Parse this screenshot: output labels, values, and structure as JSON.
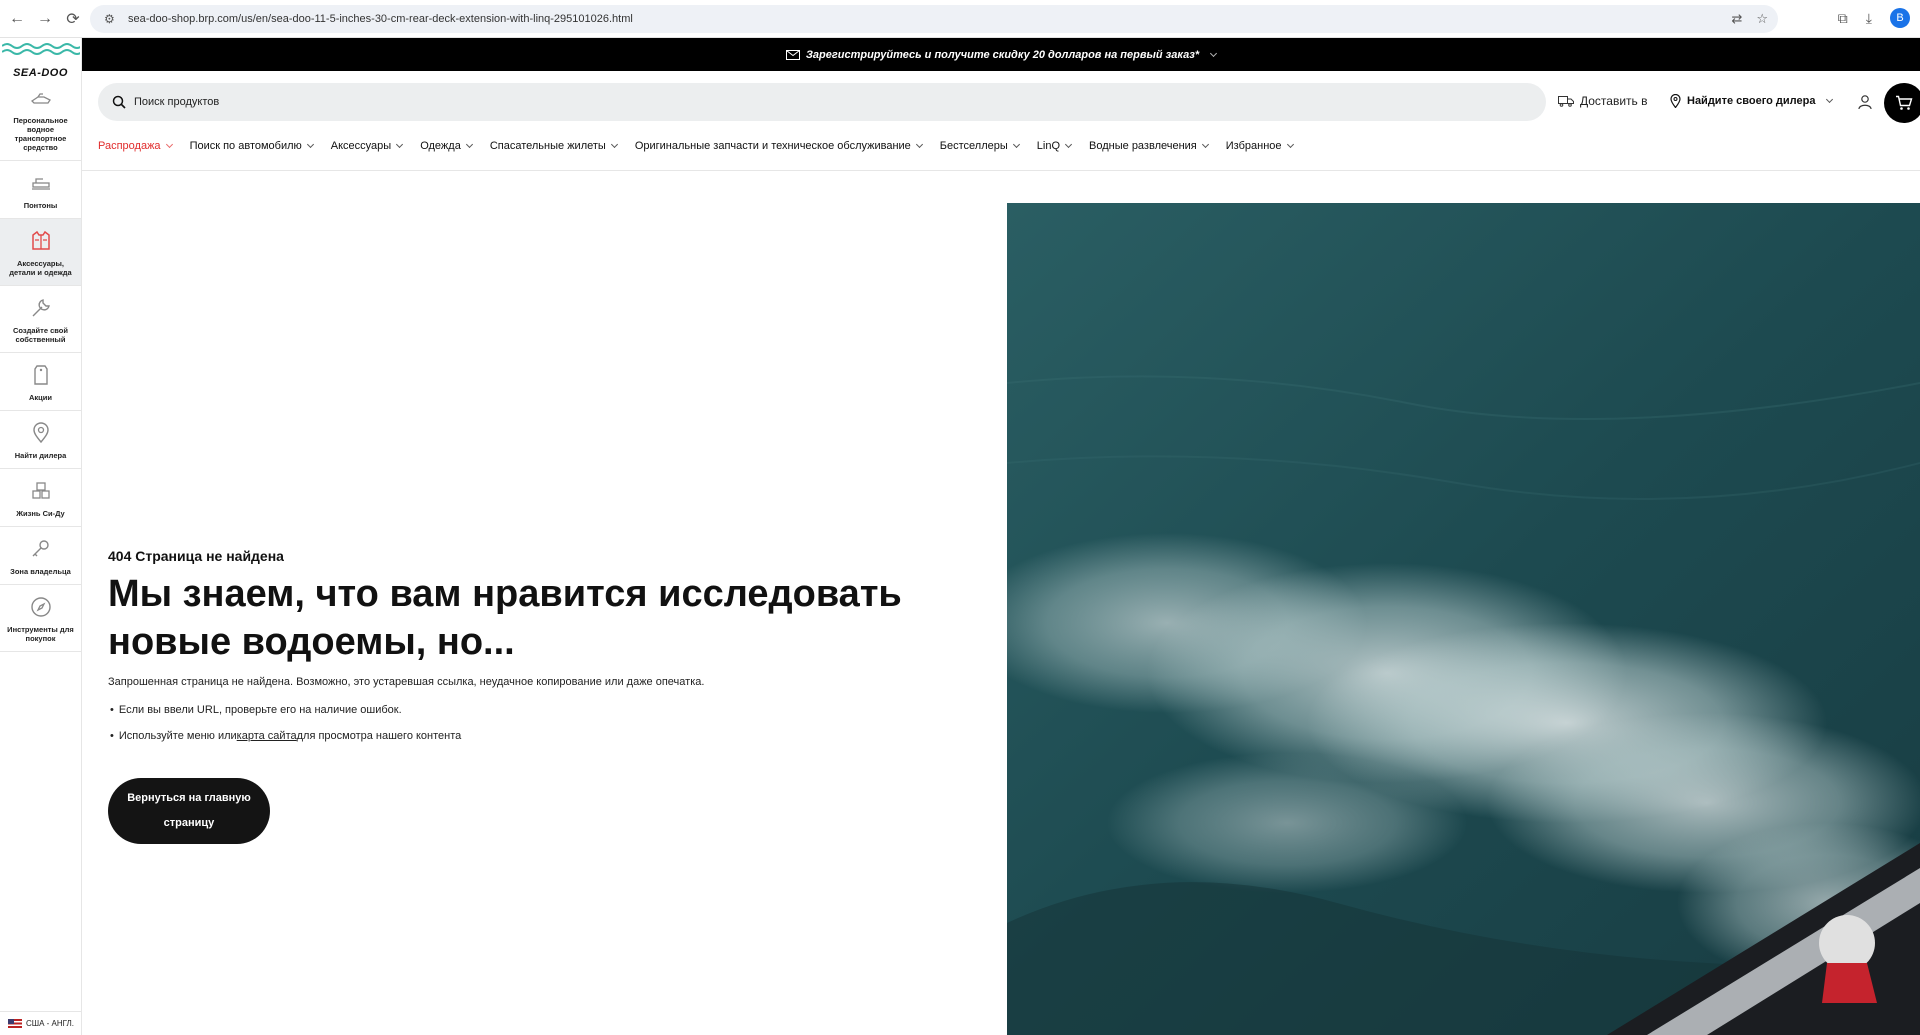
{
  "browser": {
    "url": "sea-doo-shop.brp.com/us/en/sea-doo-11-5-inches-30-cm-rear-deck-extension-with-linq-295101026.html",
    "profile_initial": "B"
  },
  "sidebar": {
    "brand": "SEA-DOO",
    "items": [
      {
        "label": "Персональное водное транспортное средство",
        "icon": "jetski-icon"
      },
      {
        "label": "Понтоны",
        "icon": "pontoon-icon"
      },
      {
        "label": "Аксессуары, детали и одежда",
        "icon": "life-vest-icon"
      },
      {
        "label": "Создайте свой собственный",
        "icon": "wrench-icon"
      },
      {
        "label": "Акции",
        "icon": "tag-icon"
      },
      {
        "label": "Найти дилера",
        "icon": "location-pin-icon"
      },
      {
        "label": "Жизнь Си-Ду",
        "icon": "community-icon"
      },
      {
        "label": "Зона владельца",
        "icon": "key-icon"
      },
      {
        "label": "Инструменты для покупок",
        "icon": "compass-icon"
      }
    ],
    "locale": "США - АНГЛ."
  },
  "promo": {
    "text": "Зарегистрируйтесь и получите скидку 20 долларов на первый заказ*"
  },
  "header": {
    "search_placeholder": "Поиск продуктов",
    "deliver_to": "Доставить в",
    "find_dealer": "Найдите своего дилера"
  },
  "menu": [
    "Распродажа",
    "Поиск по автомобилю",
    "Аксессуары",
    "Одежда",
    "Спасательные жилеты",
    "Оригинальные запчасти и техническое обслуживание",
    "Бестселлеры",
    "LinQ",
    "Водные развлечения",
    "Избранное"
  ],
  "page": {
    "kicker": "404 Страница не найдена",
    "title": "Мы знаем, что вам нравится исследовать новые водоемы, но...",
    "description": "Запрошенная страница не найдена. Возможно, это устаревшая ссылка, неудачное копирование или даже опечатка.",
    "bullet1": "Если вы ввели URL, проверьте его на наличие ошибок.",
    "bullet2_prefix": "Используйте меню или",
    "bullet2_link": "карта сайта",
    "bullet2_suffix": "для просмотра нашего контента",
    "home_button": "Вернуться на главную страницу"
  },
  "colors": {
    "accent_sale": "#e12c2c",
    "promo_bg": "#000000",
    "button_bg": "#141414",
    "sea": "#1f4a50"
  }
}
